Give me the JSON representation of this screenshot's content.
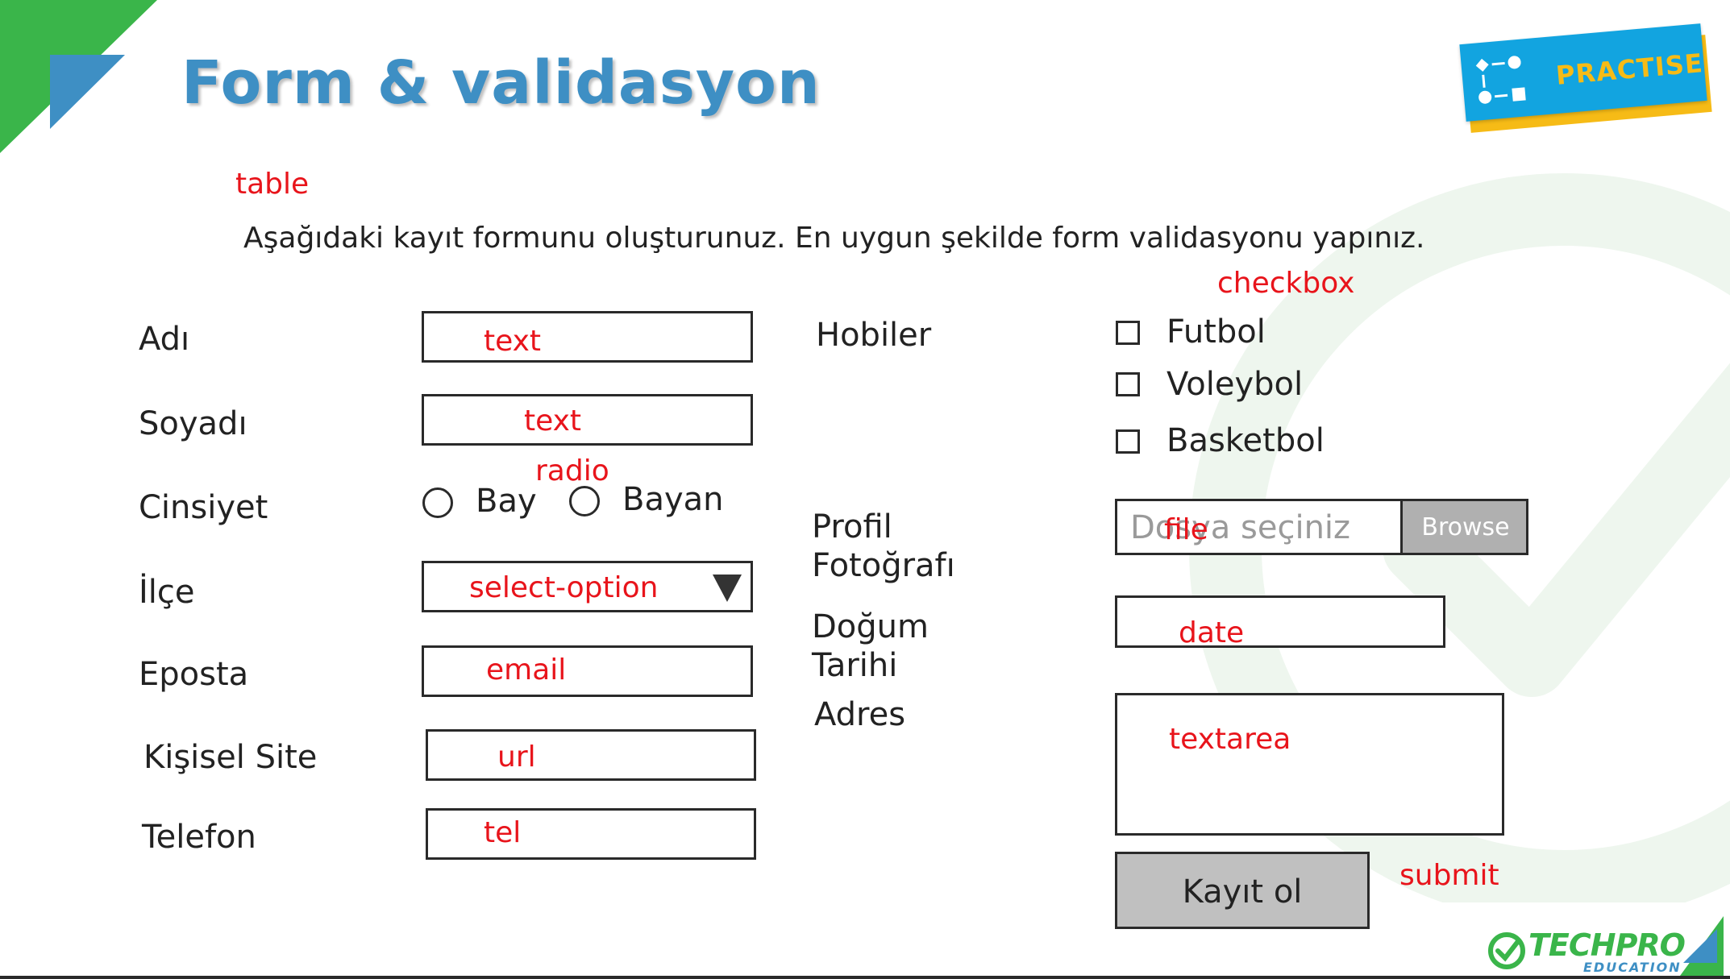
{
  "slide": {
    "title": "Form & validasyon",
    "instruction": "Aşağıdaki kayıt formunu oluşturunuz. En uygun şekilde form validasyonu yapınız.",
    "badge": "PRACTISE",
    "logo_main": "TECHPRO",
    "logo_sub": "EDUCATION"
  },
  "colors": {
    "title": "#3e8fc4",
    "annotation": "#e8141b",
    "corner_green": "#3ab54a",
    "corner_blue": "#3e8fc4",
    "badge_blue": "#12a4e0",
    "badge_yellow": "#f6bb16",
    "badge_text": "#f6bb16",
    "browse_bg": "#b0b0b0",
    "submit_bg": "#c0c0c0"
  },
  "annotations": {
    "table": "table",
    "checkbox": "checkbox",
    "radio": "radio",
    "file": "file",
    "date": "date",
    "textarea": "textarea",
    "submit": "submit"
  },
  "form": {
    "left": [
      {
        "label": "Adı",
        "type_note": "text"
      },
      {
        "label": "Soyadı",
        "type_note": "text"
      },
      {
        "label": "Cinsiyet"
      },
      {
        "label": "İlçe",
        "type_note": "select-option"
      },
      {
        "label": "Eposta",
        "type_note": "email"
      },
      {
        "label": "Kişisel Site",
        "type_note": "url"
      },
      {
        "label": "Telefon",
        "type_note": "tel"
      }
    ],
    "gender_options": [
      "Bay",
      "Bayan"
    ],
    "hobbies_label": "Hobiler",
    "hobbies": [
      "Futbol",
      "Voleybol",
      "Basketbol"
    ],
    "photo_label_line1": "Profil",
    "photo_label_line2": "Fotoğrafı",
    "file_placeholder": "Dosya seçiniz",
    "browse_label": "Browse",
    "birth_label_line1": "Doğum",
    "birth_label_line2": "Tarihi",
    "address_label": "Adres",
    "submit_label": "Kayıt ol"
  }
}
